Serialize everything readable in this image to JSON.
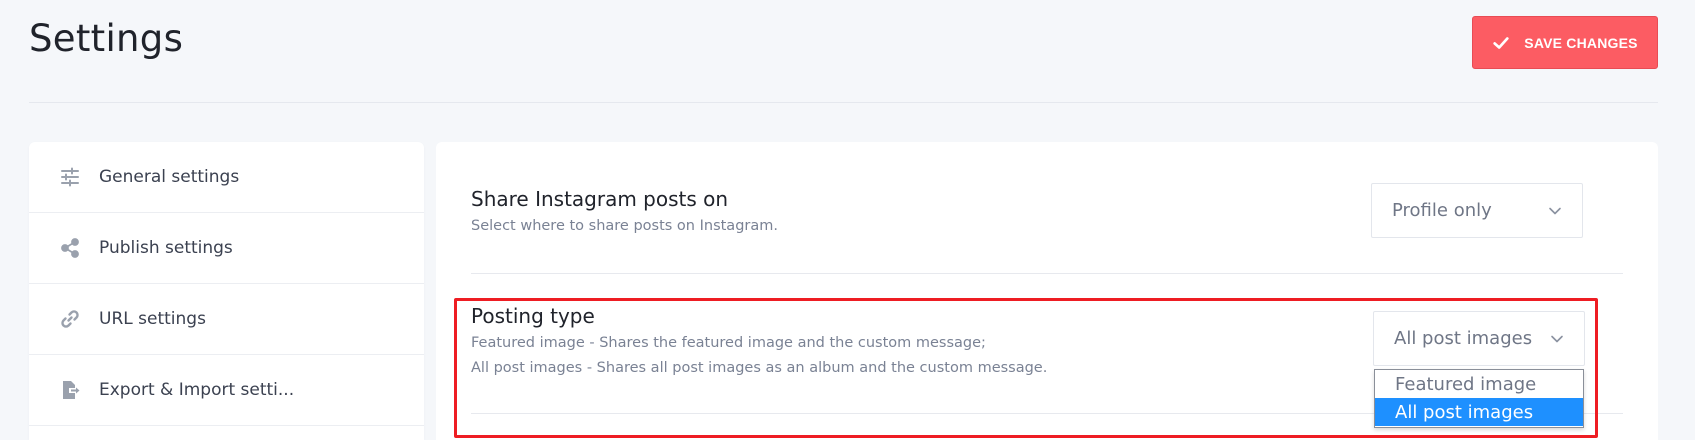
{
  "page": {
    "title": "Settings",
    "save_label": "SAVE CHANGES"
  },
  "sidebar": {
    "items": [
      {
        "label": "General settings",
        "icon": "sliders-icon"
      },
      {
        "label": "Publish settings",
        "icon": "share-icon"
      },
      {
        "label": "URL settings",
        "icon": "link-icon"
      },
      {
        "label": "Export & Import setti..."
      }
    ]
  },
  "settings": {
    "share_on": {
      "title": "Share Instagram posts on",
      "description": "Select where to share posts on Instagram.",
      "value": "Profile only"
    },
    "posting_type": {
      "title": "Posting type",
      "description_line1": "Featured image - Shares the featured image and the custom message;",
      "description_line2": "All post images - Shares all post images as an album and the custom message.",
      "value": "All post images",
      "options": [
        "Featured image",
        "All post images"
      ],
      "selected_option": "All post images"
    }
  },
  "colors": {
    "accent": "#fc5c63",
    "highlight": "#ee1d23",
    "dropdown_selected": "#1e90ff",
    "background": "#f5f7fa"
  }
}
